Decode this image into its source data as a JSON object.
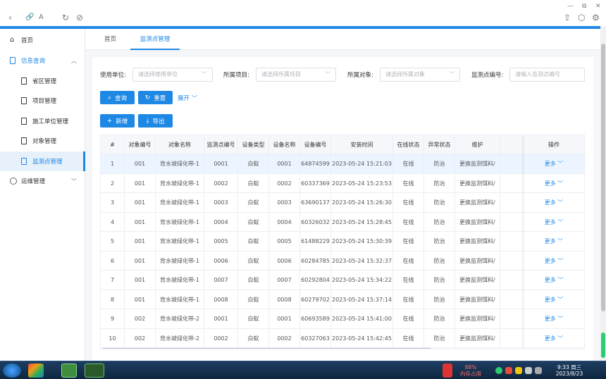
{
  "sidebar": {
    "home": "首页",
    "info_query": "信息查询",
    "items": [
      "省区管理",
      "项目管理",
      "施工单位管理",
      "对象管理",
      "监测点管理"
    ],
    "ops": "运维管理"
  },
  "tabs": [
    "首页",
    "监测点管理"
  ],
  "filters": {
    "unit_label": "使用单位:",
    "unit_placeholder": "请选择使用单位",
    "project_label": "所属项目:",
    "project_placeholder": "请选择所属项目",
    "object_label": "所属对象:",
    "object_placeholder": "请选择所属对象",
    "point_label": "监测点编号:",
    "point_placeholder": "请输入监测点编号"
  },
  "buttons": {
    "query": "查询",
    "reset": "重置",
    "expand": "展开",
    "add": "新增",
    "export": "导出"
  },
  "table": {
    "headers": [
      "#",
      "对象编号",
      "对象名称",
      "监测点编号",
      "设备类型",
      "设备名称",
      "设备编号",
      "安装时间",
      "在线状态",
      "异常状态",
      "维护",
      "操作"
    ],
    "rows": [
      [
        "1",
        "001",
        "背水坡绿化带-1",
        "0001",
        "白蚁",
        "0001",
        "64874599",
        "2023-05-24 15:21:03",
        "在线",
        "防治",
        "更换监测饵料/",
        "更多"
      ],
      [
        "2",
        "001",
        "背水坡绿化带-1",
        "0002",
        "白蚁",
        "0002",
        "60337369",
        "2023-05-24 15:23:53",
        "在线",
        "防治",
        "更换监测饵料/",
        "更多"
      ],
      [
        "3",
        "001",
        "背水坡绿化带-1",
        "0003",
        "白蚁",
        "0003",
        "63690137",
        "2023-05-24 15:26:30",
        "在线",
        "防治",
        "更换监测饵料/",
        "更多"
      ],
      [
        "4",
        "001",
        "背水坡绿化带-1",
        "0004",
        "白蚁",
        "0004",
        "60326032",
        "2023-05-24 15:28:45",
        "在线",
        "防治",
        "更换监测饵料/",
        "更多"
      ],
      [
        "5",
        "001",
        "背水坡绿化带-1",
        "0005",
        "白蚁",
        "0005",
        "61488229",
        "2023-05-24 15:30:39",
        "在线",
        "防治",
        "更换监测饵料/",
        "更多"
      ],
      [
        "6",
        "001",
        "背水坡绿化带-1",
        "0006",
        "白蚁",
        "0006",
        "60284785",
        "2023-05-24 15:32:37",
        "在线",
        "防治",
        "更换监测饵料/",
        "更多"
      ],
      [
        "7",
        "001",
        "背水坡绿化带-1",
        "0007",
        "白蚁",
        "0007",
        "60292804",
        "2023-05-24 15:34:22",
        "在线",
        "防治",
        "更换监测饵料/",
        "更多"
      ],
      [
        "8",
        "001",
        "背水坡绿化带-1",
        "0008",
        "白蚁",
        "0008",
        "60279702",
        "2023-05-24 15:37:14",
        "在线",
        "防治",
        "更换监测饵料/",
        "更多"
      ],
      [
        "9",
        "002",
        "背水坡绿化带-2",
        "0001",
        "白蚁",
        "0001",
        "60693589",
        "2023-05-24 15:41:00",
        "在线",
        "防治",
        "更换监测饵料/",
        "更多"
      ],
      [
        "10",
        "002",
        "背水坡绿化带-2",
        "0002",
        "白蚁",
        "0002",
        "60327063",
        "2023-05-24 15:42:45",
        "在线",
        "防治",
        "更换监测饵料/",
        "更多"
      ]
    ]
  },
  "taskbar": {
    "mem_percent": "88%",
    "mem_label": "内存占用",
    "time": "9:33 周三",
    "date": "2023/8/23"
  },
  "colors": {
    "accent": "#1e88e5",
    "highlight_row": "#ecf5ff"
  }
}
